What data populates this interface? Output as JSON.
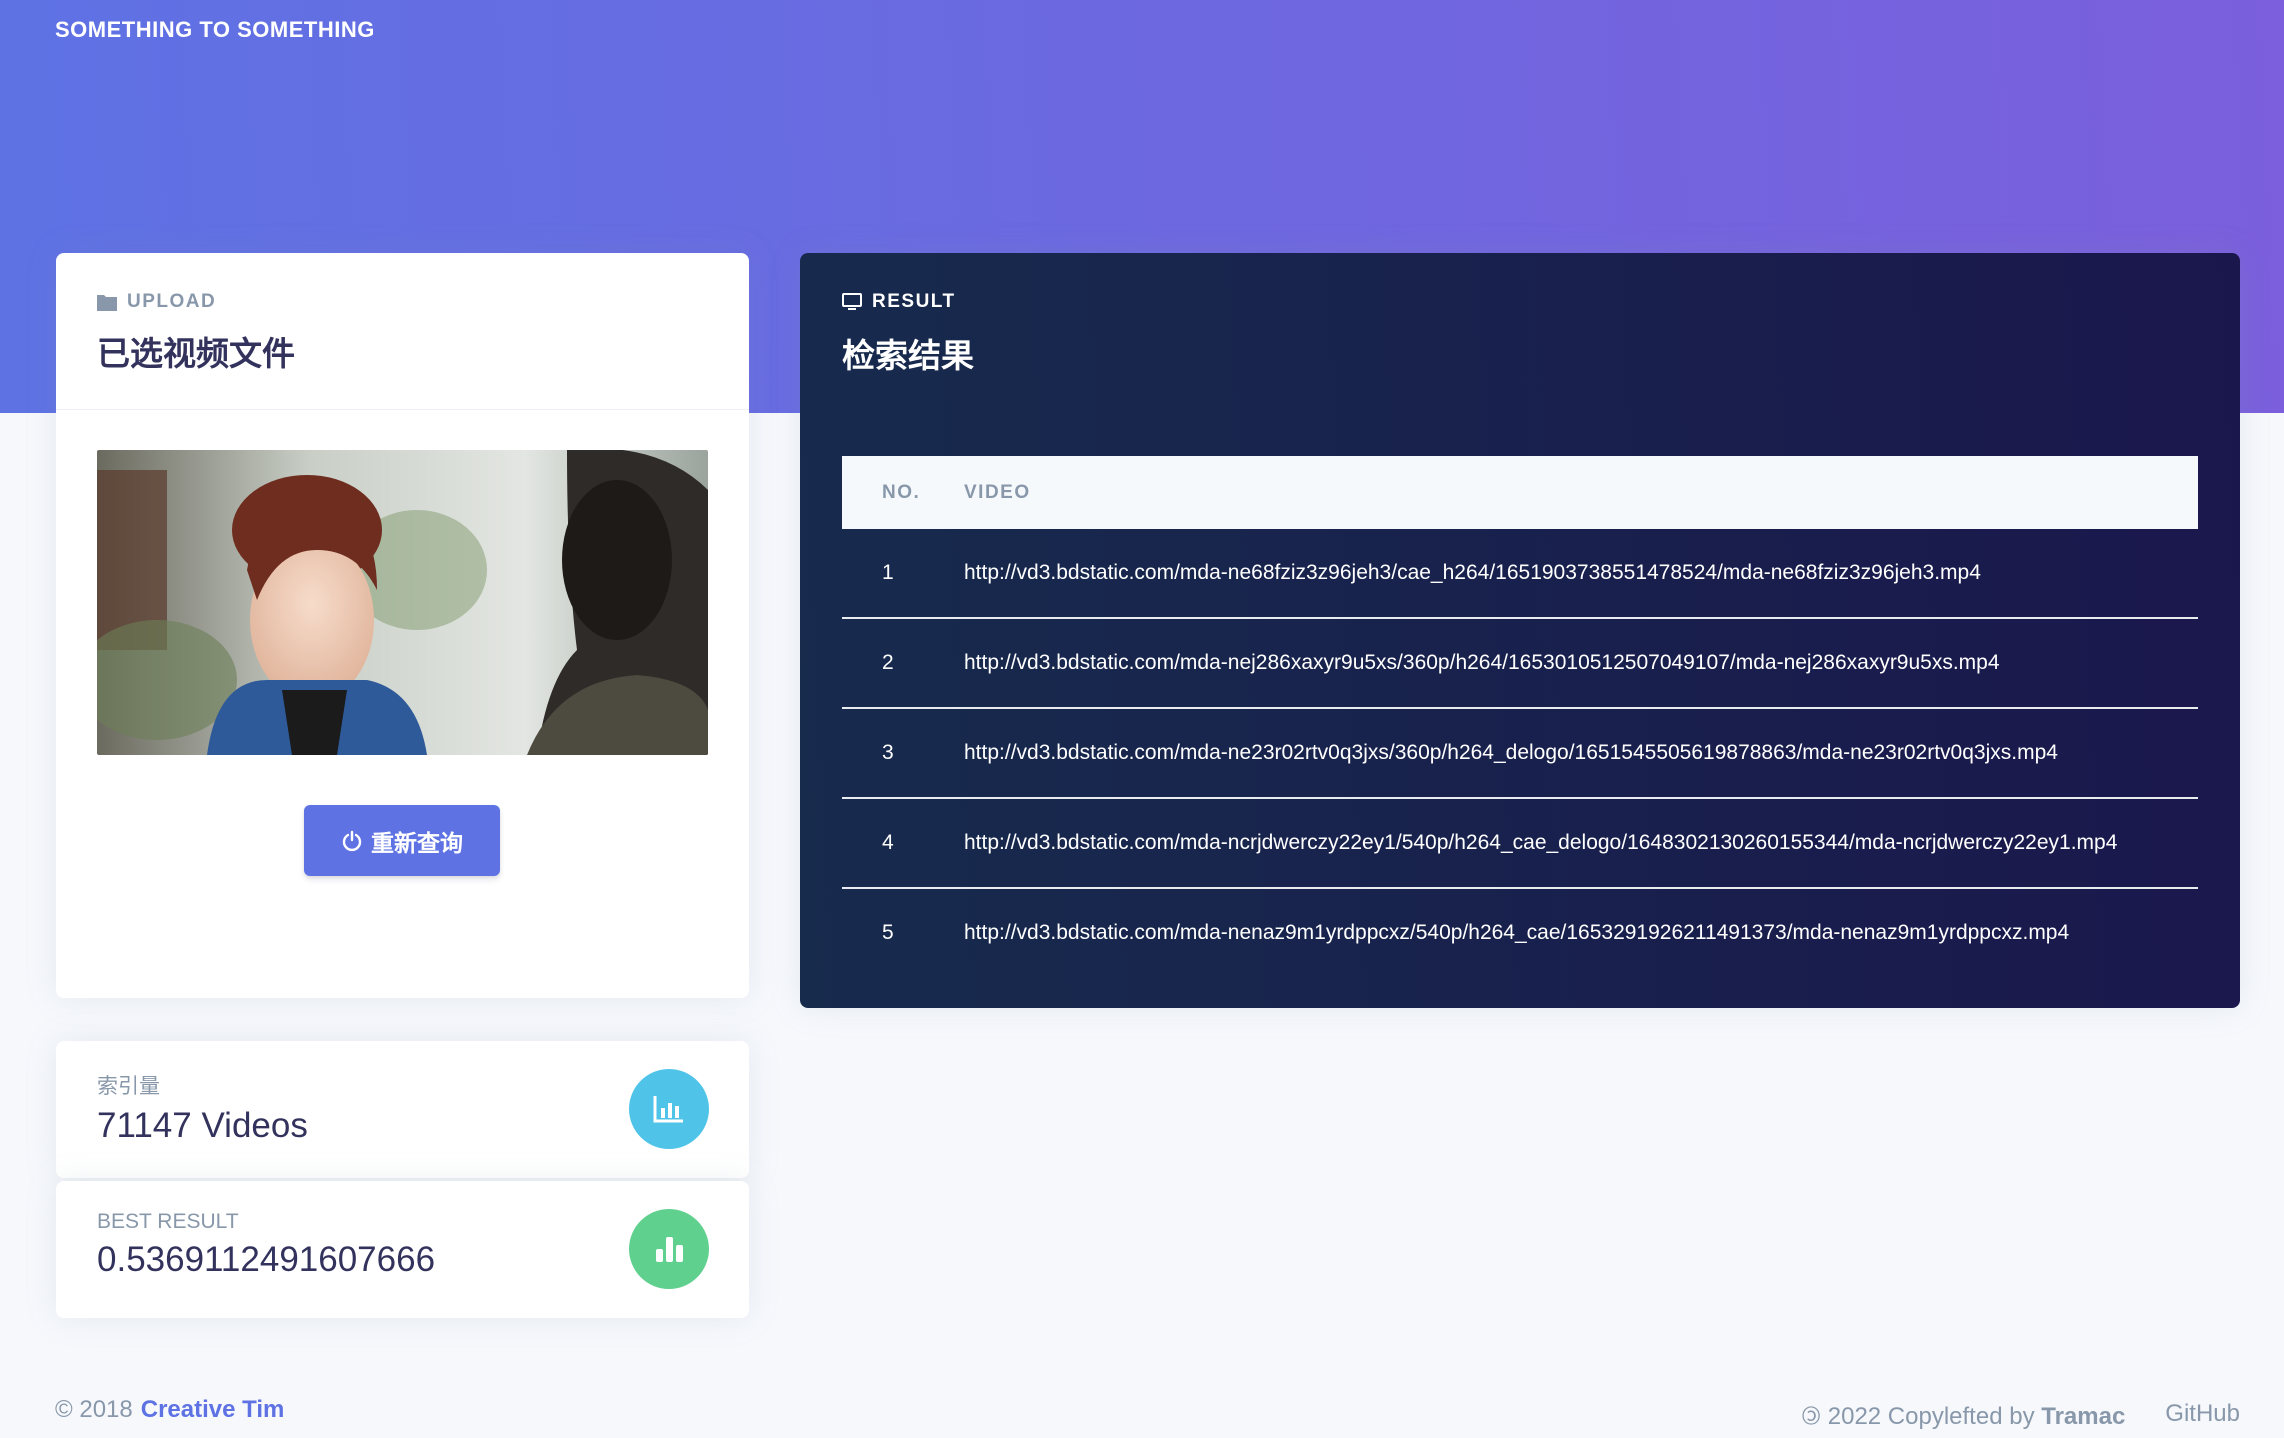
{
  "brand": "SOMETHING TO SOMETHING",
  "upload": {
    "eyebrow": "UPLOAD",
    "title": "已选视频文件",
    "button_label": "重新查询"
  },
  "stats": [
    {
      "label": "索引量",
      "value": "71147 Videos",
      "icon": "chart-bar-icon",
      "color": "#4fc4e8"
    },
    {
      "label": "BEST RESULT",
      "value": "0.5369112491607666",
      "icon": "bar-chart-icon",
      "color": "#5fd08e"
    }
  ],
  "result": {
    "eyebrow": "RESULT",
    "title": "检索结果",
    "columns": [
      "NO.",
      "VIDEO"
    ],
    "rows": [
      {
        "no": "1",
        "video": "http://vd3.bdstatic.com/mda-ne68fziz3z96jeh3/cae_h264/1651903738551478524/mda-ne68fziz3z96jeh3.mp4"
      },
      {
        "no": "2",
        "video": "http://vd3.bdstatic.com/mda-nej286xaxyr9u5xs/360p/h264/1653010512507049107/mda-nej286xaxyr9u5xs.mp4"
      },
      {
        "no": "3",
        "video": "http://vd3.bdstatic.com/mda-ne23r02rtv0q3jxs/360p/h264_delogo/1651545505619878863/mda-ne23r02rtv0q3jxs.mp4"
      },
      {
        "no": "4",
        "video": "http://vd3.bdstatic.com/mda-ncrjdwerczy22ey1/540p/h264_cae_delogo/1648302130260155344/mda-ncrjdwerczy22ey1.mp4"
      },
      {
        "no": "5",
        "video": "http://vd3.bdstatic.com/mda-nenaz9m1yrdppcxz/540p/h264_cae/1653291926211491373/mda-nenaz9m1yrdppcxz.mp4"
      }
    ]
  },
  "footer": {
    "copyright": "© 2018",
    "link": "Creative Tim",
    "copyleft_prefix": "2022 Copylefted by",
    "copyleft_author": "Tramac",
    "github": "GitHub"
  },
  "colors": {
    "primary": "#5e72e4",
    "dark": "#172b4d"
  }
}
